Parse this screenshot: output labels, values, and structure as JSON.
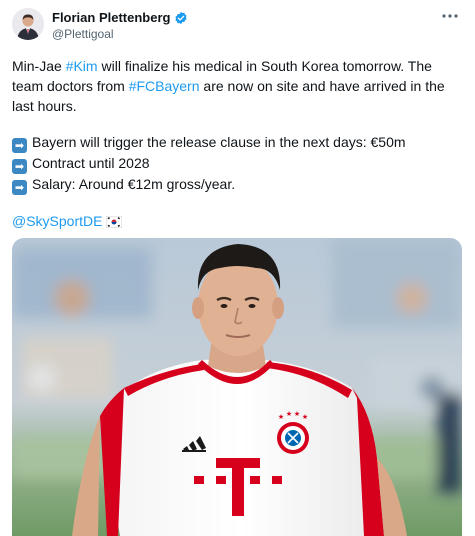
{
  "author": {
    "name": "Florian Plettenberg",
    "handle": "@Plettigoal"
  },
  "tweet": {
    "p1": {
      "t1": "Min-Jae ",
      "tag1": "#Kim",
      "t2": " will finalize his medical in South Korea tomorrow. The team doctors from ",
      "tag2": "#FCBayern",
      "t3": " are now on site and have arrived in the last hours."
    },
    "bullets": [
      "Bayern will trigger the release clause in the next days: €50m",
      "Contract until 2028",
      "Salary: Around €12m gross/year."
    ],
    "mention": "@SkySportDE"
  },
  "colors": {
    "link": "#1d9bf0",
    "verified": "#1d9bf0",
    "jersey_red": "#d6001c"
  },
  "icons": {
    "verified": "verified-badge-icon",
    "more": "more-options-icon",
    "bullet": "right-arrow-emoji",
    "flag": "south-korea-flag-emoji"
  }
}
